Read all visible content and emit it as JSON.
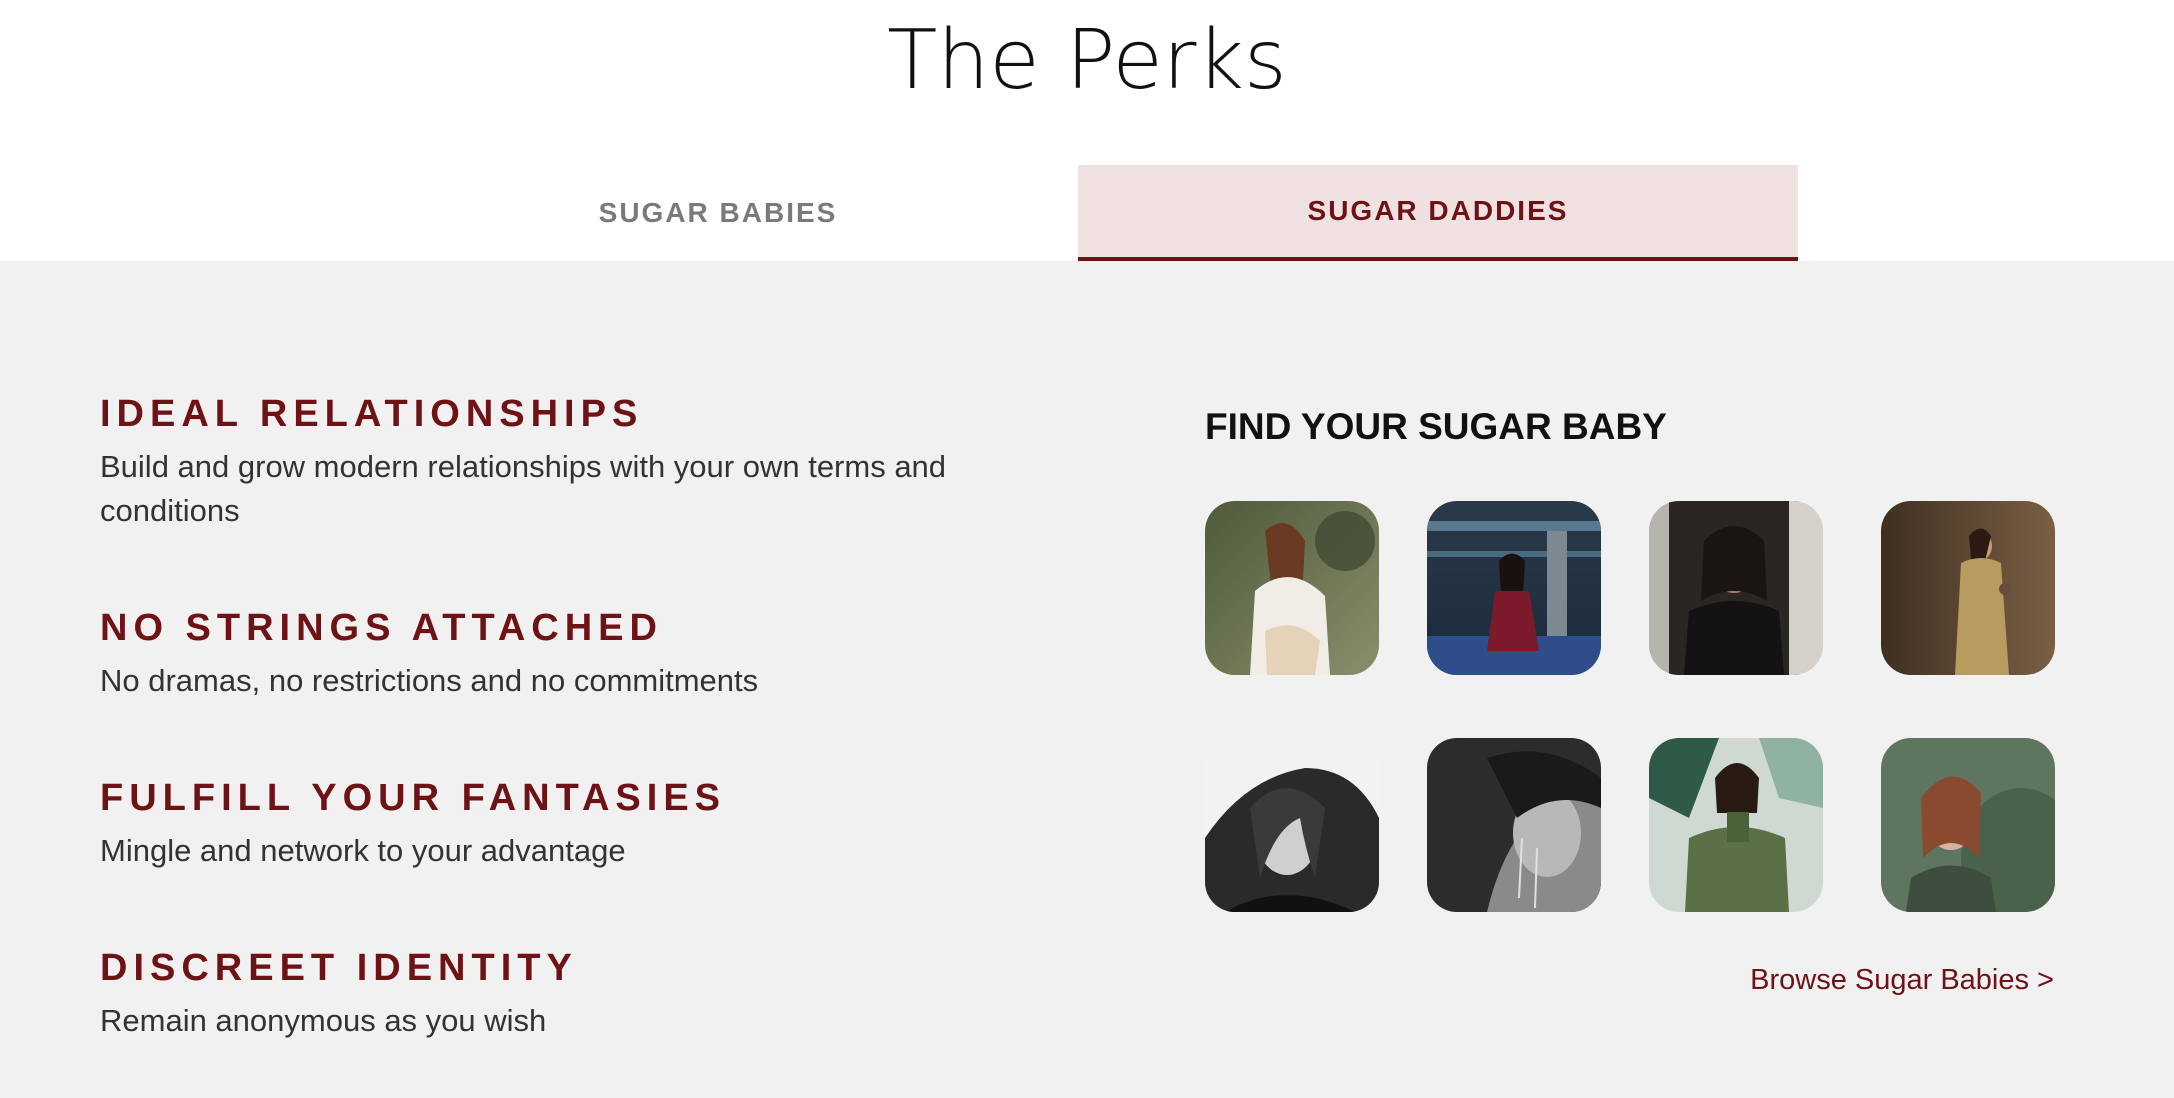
{
  "page": {
    "title": "The Perks"
  },
  "tabs": [
    {
      "label": "SUGAR BABIES",
      "active": false
    },
    {
      "label": "SUGAR DADDIES",
      "active": true
    }
  ],
  "perks": [
    {
      "title": "IDEAL RELATIONSHIPS",
      "description": "Build and grow modern relationships with your own terms and conditions"
    },
    {
      "title": "NO STRINGS ATTACHED",
      "description": "No dramas, no restrictions and no commitments"
    },
    {
      "title": "FULFILL YOUR FANTASIES",
      "description": "Mingle and network to your advantage"
    },
    {
      "title": "DISCREET IDENTITY",
      "description": "Remain anonymous as you wish"
    }
  ],
  "gallery": {
    "title": "FIND YOUR SUGAR BABY",
    "browse_link": "Browse Sugar Babies >"
  },
  "colors": {
    "accent": "#6e1216",
    "active_tab_bg": "#efe1e2",
    "inactive_tab_text": "#7a7a7a",
    "section_bg": "#f1f1f1",
    "body_text": "#333333"
  }
}
